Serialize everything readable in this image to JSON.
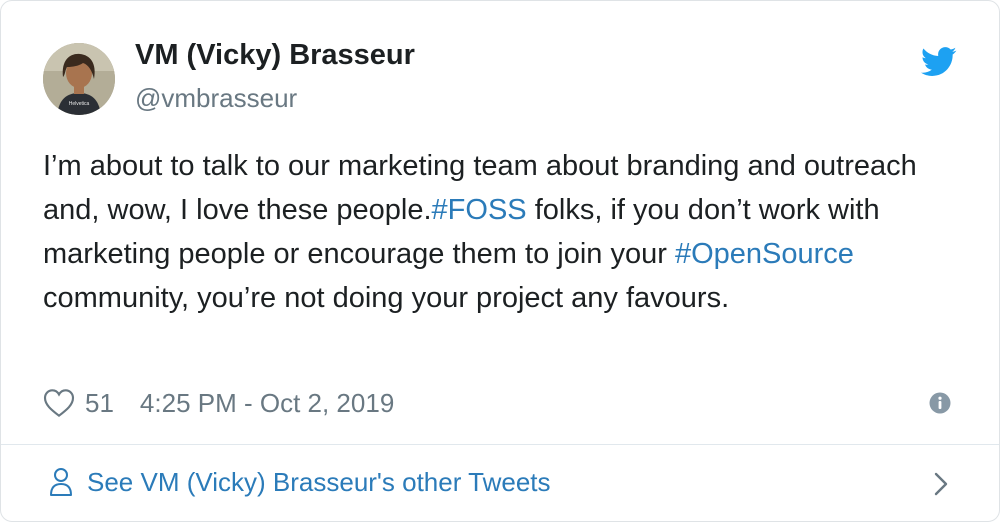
{
  "author": {
    "display_name": "VM (Vicky) Brasseur",
    "handle": "@vmbrasseur",
    "avatar_icon": "profile-photo",
    "shirt_text": "Helvetica"
  },
  "tweet": {
    "segments": [
      {
        "text": "I’m about to talk to our marketing team about branding and outreach and, wow, I love these people.",
        "type": "text"
      },
      {
        "text": "#FOSS",
        "type": "hashtag"
      },
      {
        "text": " folks, if you don’t work with marketing people or encourage them to join your ",
        "type": "text"
      },
      {
        "text": "#OpenSource",
        "type": "hashtag"
      },
      {
        "text": " community, you’re not doing your project any favours.",
        "type": "text"
      }
    ]
  },
  "meta": {
    "like_count": "51",
    "timestamp": "4:25 PM - Oct 2, 2019",
    "like_icon": "heart-outline-icon",
    "info_icon": "info-icon"
  },
  "footer": {
    "label": "See VM (Vicky) Brasseur's other Tweets",
    "icon": "person-icon",
    "chevron": "chevron-right-icon"
  },
  "colors": {
    "link": "#2b7bb9",
    "twitter_blue": "#1da1f2",
    "muted": "#697882",
    "text": "#1c2022",
    "border": "#dfe3e6"
  }
}
